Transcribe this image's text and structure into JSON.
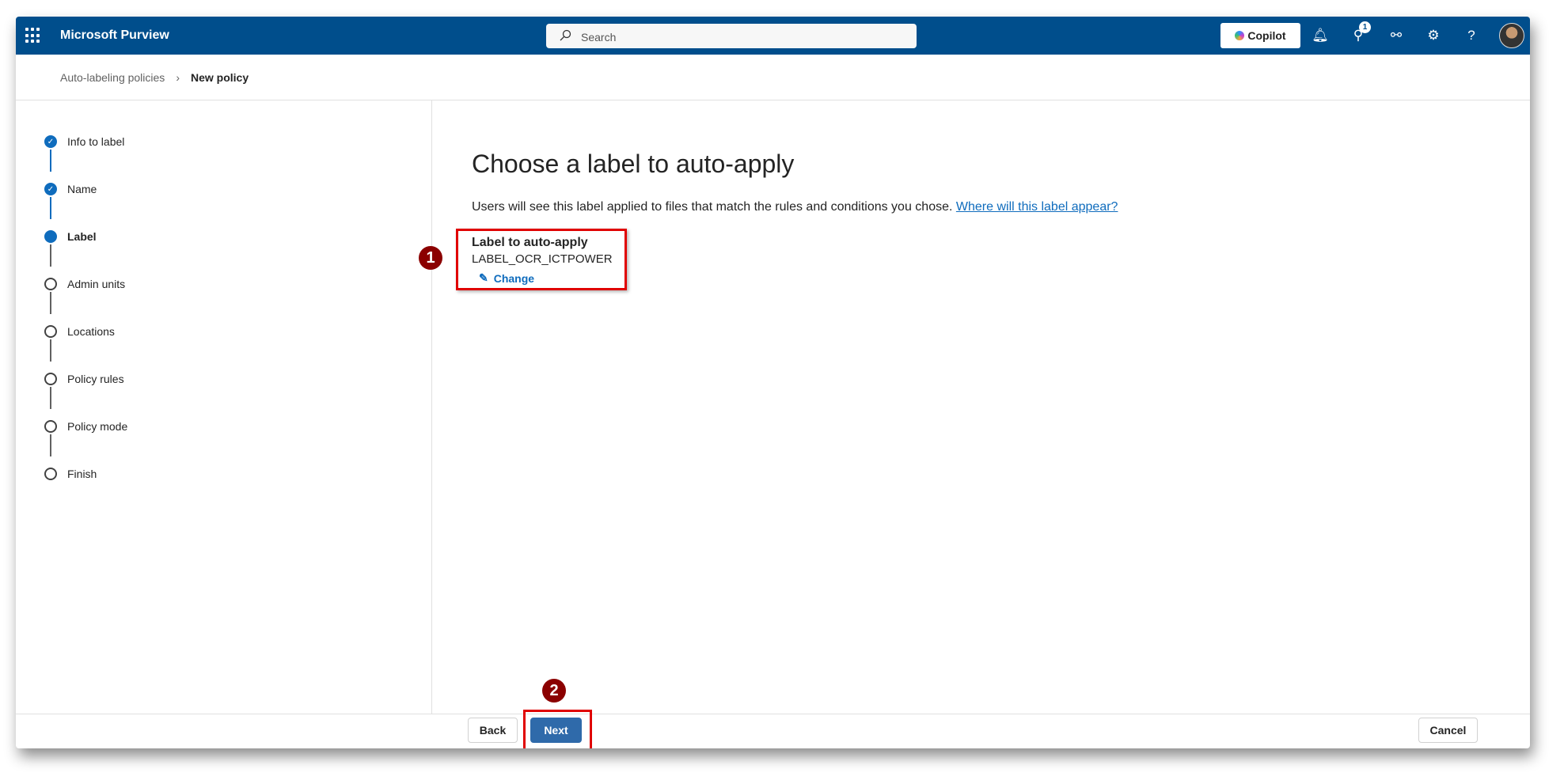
{
  "header": {
    "app_title": "Microsoft Purview",
    "search_placeholder": "Search",
    "copilot_label": "Copilot",
    "notification_badge": "1",
    "brand_color": "#004e8c"
  },
  "breadcrumb": {
    "parent": "Auto-labeling policies",
    "current": "New policy"
  },
  "steps": [
    {
      "label": "Info to label",
      "state": "done"
    },
    {
      "label": "Name",
      "state": "done"
    },
    {
      "label": "Label",
      "state": "current"
    },
    {
      "label": "Admin units",
      "state": "pending"
    },
    {
      "label": "Locations",
      "state": "pending"
    },
    {
      "label": "Policy rules",
      "state": "pending"
    },
    {
      "label": "Policy mode",
      "state": "pending"
    },
    {
      "label": "Finish",
      "state": "pending"
    }
  ],
  "main": {
    "title": "Choose a label to auto-apply",
    "description": "Users will see this label applied to files that match the rules and conditions you chose.",
    "help_link": "Where will this label appear?",
    "label_heading": "Label to auto-apply",
    "label_value": "LABEL_OCR_ICTPOWER",
    "change_label": "Change"
  },
  "annotations": [
    "1",
    "2"
  ],
  "footer": {
    "back": "Back",
    "next": "Next",
    "cancel": "Cancel"
  }
}
